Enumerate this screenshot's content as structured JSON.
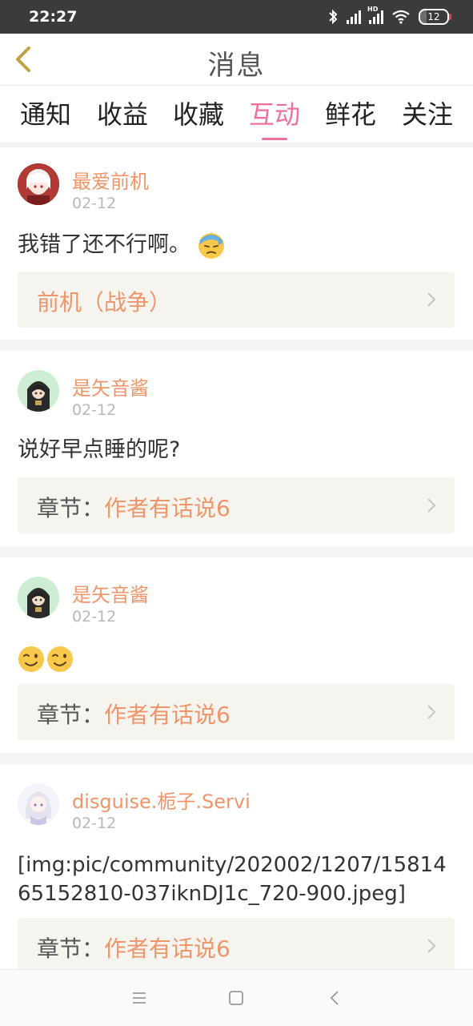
{
  "status": {
    "time": "22:27",
    "battery": "12",
    "hd": "HD"
  },
  "navbar": {
    "title": "消息"
  },
  "tabs": [
    "通知",
    "收益",
    "收藏",
    "互动",
    "鲜花",
    "关注"
  ],
  "active_tab": "互动",
  "items": [
    {
      "user": "最爱前机",
      "date": "02-12",
      "text": "我错了还不行啊。",
      "emoji": "downcast-sweat-face",
      "link_label": "前机（战争）",
      "link_prefix": ""
    },
    {
      "user": "是矢音酱",
      "date": "02-12",
      "text": "说好早点睡的呢?",
      "link_prefix": "章节：",
      "link_label": "作者有话说6"
    },
    {
      "user": "是矢音酱",
      "date": "02-12",
      "text": "",
      "emoji": "winking-face",
      "link_prefix": "章节：",
      "link_label": "作者有话说6"
    },
    {
      "user": "disguise.栀子.Servi",
      "date": "02-12",
      "text": "[img:pic/community/202002/1207/1581465152810-037iknDJ1c_720-900.jpeg]",
      "link_prefix": "章节：",
      "link_label": "作者有话说6"
    }
  ],
  "colors": {
    "accent_pink": "#ee6fa0",
    "name_orange": "#f0956a",
    "link_bg": "#f5f4ee"
  }
}
